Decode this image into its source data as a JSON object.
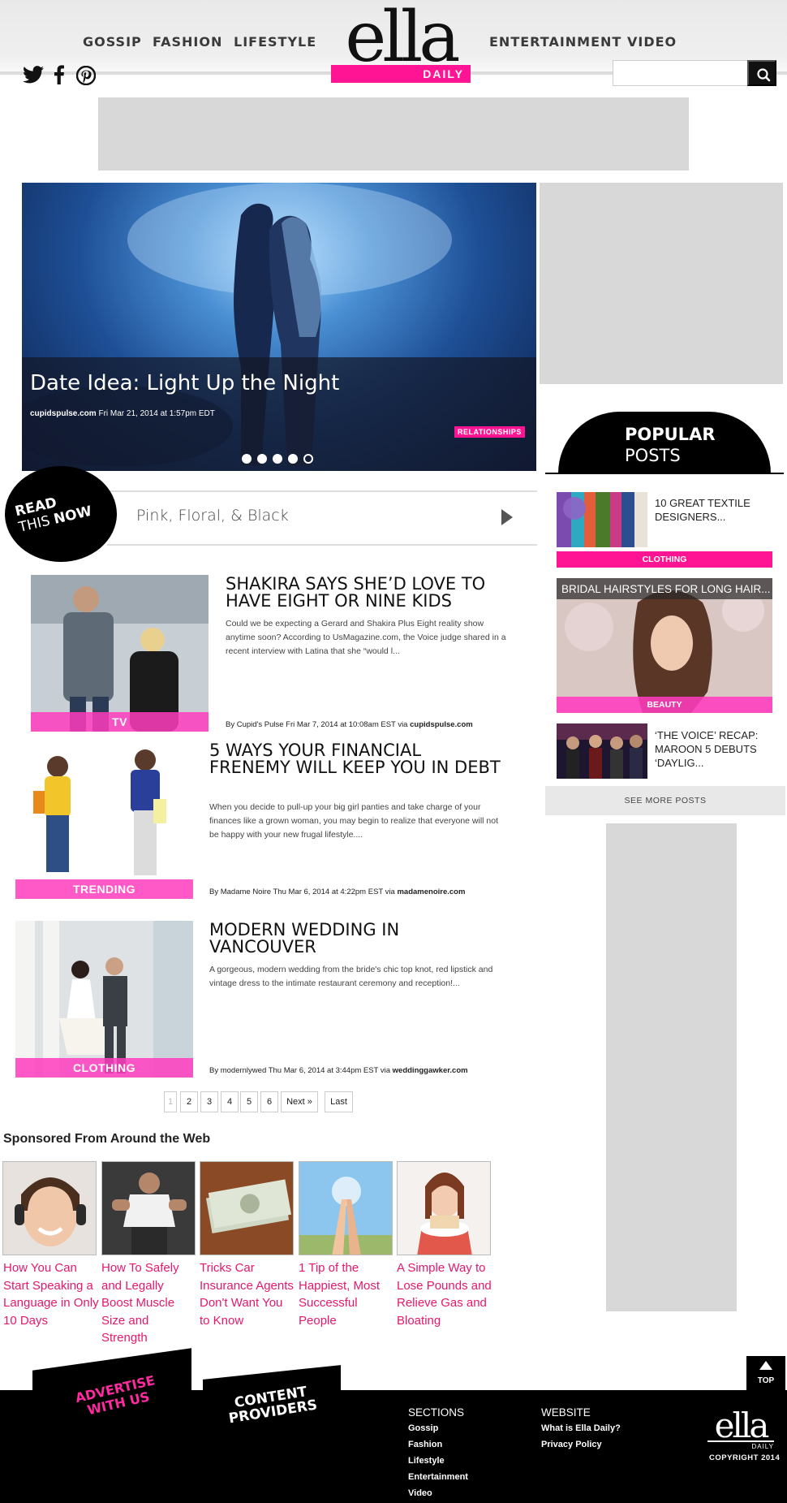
{
  "colors": {
    "accent": "#ff1493",
    "link": "#e6176d",
    "footer_bg": "#000000",
    "ad_placeholder": "#d8d8d8"
  },
  "nav": {
    "left": [
      "GOSSIP",
      "FASHION",
      "LIFESTYLE"
    ],
    "right": [
      "ENTERTAINMENT",
      "VIDEO"
    ]
  },
  "logo": {
    "main": "ella",
    "sub": "DAILY"
  },
  "social": [
    "twitter-icon",
    "facebook-icon",
    "pinterest-icon"
  ],
  "search": {
    "placeholder": "",
    "button_icon": "search-icon"
  },
  "hero": {
    "title": "Date Idea: Light Up the Night",
    "source": "cupidspulse.com",
    "date": "Fri Mar 21, 2014 at 1:57pm EDT",
    "tag": "RELATIONSHIPS",
    "slides": 5,
    "active_slide": 5
  },
  "read_this_now": {
    "label_line1": "READ",
    "label_line2": "THIS",
    "label_line3": "NOW",
    "headline": "Pink, Floral, & Black"
  },
  "articles": [
    {
      "title": "SHAKIRA SAYS SHE’D LOVE TO HAVE EIGHT OR NINE KIDS",
      "excerpt": "Could we be expecting a Gerard and Shakira Plus Eight reality show anytime soon? According to UsMagazine.com, the Voice judge shared in a recent interview with Latina that she “would l...",
      "byline": "By Cupid's Pulse Fri Mar 7, 2014 at 10:08am EST via ",
      "source": "cupidspulse.com",
      "tag": "TV"
    },
    {
      "title": "5 WAYS YOUR FINANCIAL FRENEMY WILL KEEP YOU IN DEBT",
      "excerpt": "When you decide to pull-up your big girl panties and take charge of your finances like a grown woman, you may begin to realize that everyone will not be happy with your new frugal lifestyle....",
      "byline": "By Madame Noire Thu Mar 6, 2014 at 4:22pm EST via ",
      "source": "madamenoire.com",
      "tag": "TRENDING"
    },
    {
      "title": "MODERN WEDDING IN VANCOUVER",
      "excerpt": "A gorgeous, modern wedding from the bride's chic top knot, red lipstick and vintage dress to the intimate restaurant ceremony and reception!...",
      "byline": "By modernlywed Thu Mar 6, 2014 at 3:44pm EST via ",
      "source": "weddinggawker.com",
      "tag": "CLOTHING"
    }
  ],
  "pagination": [
    "1",
    "2",
    "3",
    "4",
    "5",
    "6",
    "Next »",
    "Last"
  ],
  "sponsored": {
    "title": "Sponsored From Around the Web",
    "items": [
      "How You Can Start Speaking a Language in Only 10 Days",
      "How To Safely and Legally Boost Muscle Size and Strength",
      "Tricks Car Insurance Agents Don't Want You to Know",
      "1 Tip of the Happiest, Most Successful People",
      "A Simple Way to Lose Pounds and Relieve Gas and Bloating"
    ]
  },
  "popular": {
    "label_bold": "POPULAR",
    "label_light": "POSTS",
    "items": [
      {
        "title": "10 GREAT TEXTILE DESIGNERS...",
        "tag": "CLOTHING"
      },
      {
        "title": "BRIDAL HAIRSTYLES FOR LONG HAIR...",
        "tag": "BEAUTY"
      },
      {
        "title": "‘THE VOICE’ RECAP: MAROON 5 DEBUTS ‘DAYLIG...",
        "tag": ""
      }
    ],
    "see_more": "SEE MORE POSTS"
  },
  "footer": {
    "advertise_line1": "ADVERTISE",
    "advertise_line2": "WITH US",
    "content_line1": "CONTENT",
    "content_line2": "PROVIDERS",
    "sections_title": "SECTIONS",
    "sections": [
      "Gossip",
      "Fashion",
      "Lifestyle",
      "Entertainment",
      "Video"
    ],
    "website_title": "WEBSITE",
    "website": [
      "What is Ella Daily?",
      "Privacy Policy"
    ],
    "top": "TOP",
    "copyright": "COPYRIGHT 2014"
  }
}
